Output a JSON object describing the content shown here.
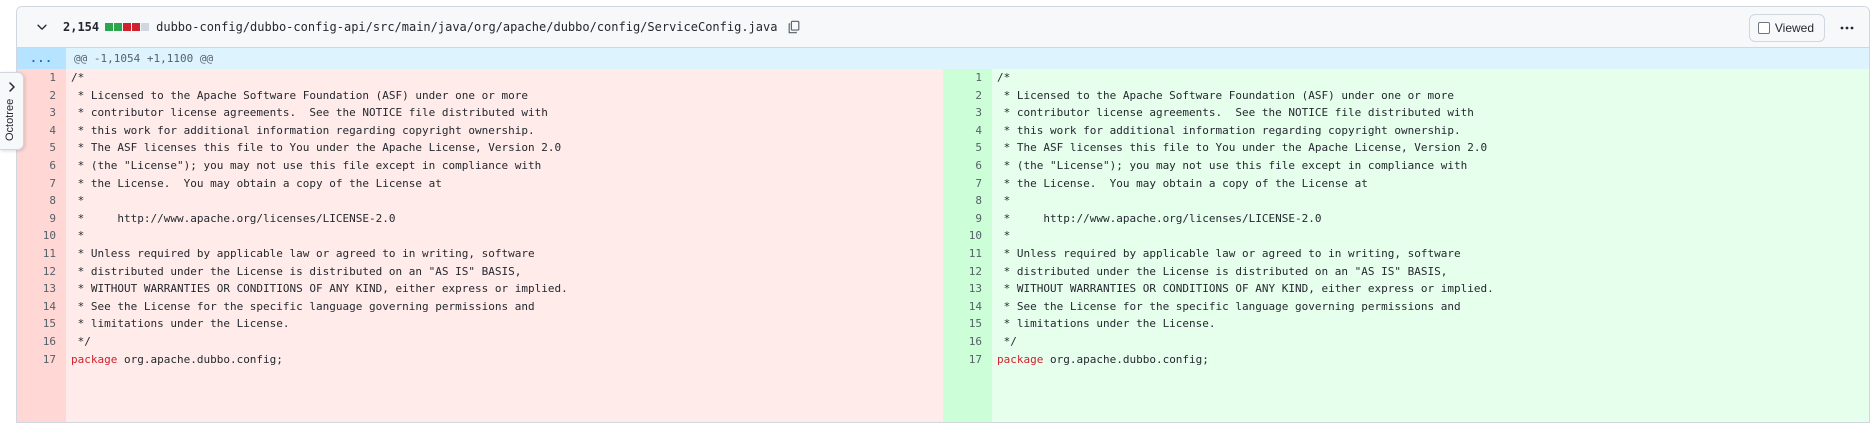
{
  "file": {
    "diffstat_count": "2,154",
    "diffstat_blocks": [
      "#2da44e",
      "#2da44e",
      "#cf222e",
      "#cf222e",
      "#d0d7de"
    ],
    "path": "dubbo-config/dubbo-config-api/src/main/java/org/apache/dubbo/config/ServiceConfig.java",
    "viewed_label": "Viewed",
    "collapse_icon": "chevron-down-icon",
    "copy_icon": "copy-icon",
    "more_icon": "kebab-horizontal-icon"
  },
  "hunk": {
    "expand_label": "...",
    "header": "@@ -1,1054 +1,1100 @@"
  },
  "octotree": {
    "label": "Octotree",
    "icon": "chevron-right-icon"
  },
  "colors": {
    "deleted_gutter": "#ffd7d5",
    "deleted_code": "#ffebe9",
    "added_gutter": "#ccffd8",
    "added_code": "#e6ffec",
    "keyword": "#cf222e"
  },
  "left_lines": [
    {
      "num": "1",
      "text": "/*"
    },
    {
      "num": "2",
      "text": " * Licensed to the Apache Software Foundation (ASF) under one or more"
    },
    {
      "num": "3",
      "text": " * contributor license agreements.  See the NOTICE file distributed with"
    },
    {
      "num": "4",
      "text": " * this work for additional information regarding copyright ownership."
    },
    {
      "num": "5",
      "text": " * The ASF licenses this file to You under the Apache License, Version 2.0"
    },
    {
      "num": "6",
      "text": " * (the \"License\"); you may not use this file except in compliance with"
    },
    {
      "num": "7",
      "text": " * the License.  You may obtain a copy of the License at"
    },
    {
      "num": "8",
      "text": " *"
    },
    {
      "num": "9",
      "text": " *     http://www.apache.org/licenses/LICENSE-2.0"
    },
    {
      "num": "10",
      "text": " *"
    },
    {
      "num": "11",
      "text": " * Unless required by applicable law or agreed to in writing, software"
    },
    {
      "num": "12",
      "text": " * distributed under the License is distributed on an \"AS IS\" BASIS,"
    },
    {
      "num": "13",
      "text": " * WITHOUT WARRANTIES OR CONDITIONS OF ANY KIND, either express or implied."
    },
    {
      "num": "14",
      "text": " * See the License for the specific language governing permissions and"
    },
    {
      "num": "15",
      "text": " * limitations under the License."
    },
    {
      "num": "16",
      "text": " */"
    },
    {
      "num": "17",
      "keyword": "package",
      "text": " org.apache.dubbo.config;"
    }
  ],
  "right_lines": [
    {
      "num": "1",
      "text": "/*"
    },
    {
      "num": "2",
      "text": " * Licensed to the Apache Software Foundation (ASF) under one or more"
    },
    {
      "num": "3",
      "text": " * contributor license agreements.  See the NOTICE file distributed with"
    },
    {
      "num": "4",
      "text": " * this work for additional information regarding copyright ownership."
    },
    {
      "num": "5",
      "text": " * The ASF licenses this file to You under the Apache License, Version 2.0"
    },
    {
      "num": "6",
      "text": " * (the \"License\"); you may not use this file except in compliance with"
    },
    {
      "num": "7",
      "text": " * the License.  You may obtain a copy of the License at"
    },
    {
      "num": "8",
      "text": " *"
    },
    {
      "num": "9",
      "text": " *     http://www.apache.org/licenses/LICENSE-2.0"
    },
    {
      "num": "10",
      "text": " *"
    },
    {
      "num": "11",
      "text": " * Unless required by applicable law or agreed to in writing, software"
    },
    {
      "num": "12",
      "text": " * distributed under the License is distributed on an \"AS IS\" BASIS,"
    },
    {
      "num": "13",
      "text": " * WITHOUT WARRANTIES OR CONDITIONS OF ANY KIND, either express or implied."
    },
    {
      "num": "14",
      "text": " * See the License for the specific language governing permissions and"
    },
    {
      "num": "15",
      "text": " * limitations under the License."
    },
    {
      "num": "16",
      "text": " */"
    },
    {
      "num": "17",
      "keyword": "package",
      "text": " org.apache.dubbo.config;"
    }
  ]
}
